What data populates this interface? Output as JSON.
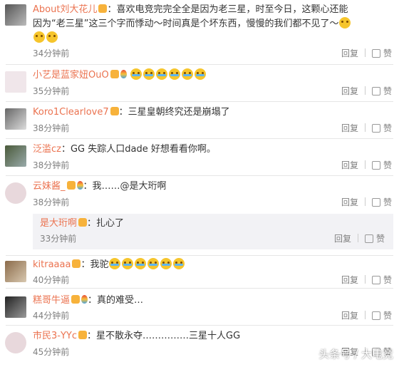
{
  "comments": [
    {
      "user": "About刘大花儿",
      "text1": "：喜欢电竞完完全全是因为老三星，时至今日，这颗心还能",
      "text2": "因为“老三星”这三个字而悸动～时间真是个坏东西，慢慢的我们都不见了～",
      "time": "34分钟前",
      "reply": "回复",
      "like": "赞"
    },
    {
      "user": "小艺是蓝家妞OuO",
      "text": "",
      "time": "35分钟前",
      "reply": "回复",
      "like": "赞"
    },
    {
      "user": "Koro1Clearlove7",
      "text": "：三星皇朝终究还是崩塌了",
      "time": "38分钟前",
      "reply": "回复",
      "like": "赞"
    },
    {
      "user": "泛滥cz",
      "text": "：GG  失踪人口dade    好想看看你啊。",
      "time": "38分钟前",
      "reply": "回复",
      "like": "赞"
    },
    {
      "user": "云妹酱_",
      "text": "：我……@是大珩啊",
      "time": "38分钟前",
      "reply": "回复",
      "like": "赞"
    },
    {
      "user": "kitraaaa",
      "text": "：我驼",
      "time": "40分钟前",
      "reply": "回复",
      "like": "赞"
    },
    {
      "user": "糕哥牛逼",
      "text": "：真的难受…",
      "time": "44分钟前",
      "reply": "回复",
      "like": "赞"
    },
    {
      "user": "市民3-YYc",
      "text": "：星不散永夺……………三星十人GG",
      "time": "45分钟前",
      "reply": "回复",
      "like": "赞"
    }
  ],
  "nested_reply": {
    "user": "是大珩啊",
    "text": "：扎心了",
    "time": "33分钟前",
    "reply": "回复",
    "like": "赞"
  },
  "watermark": "头条号 / 大电竞",
  "colors": {
    "username": "#eb7350",
    "meta": "#808080",
    "nested_bg": "#f2f2f5"
  }
}
